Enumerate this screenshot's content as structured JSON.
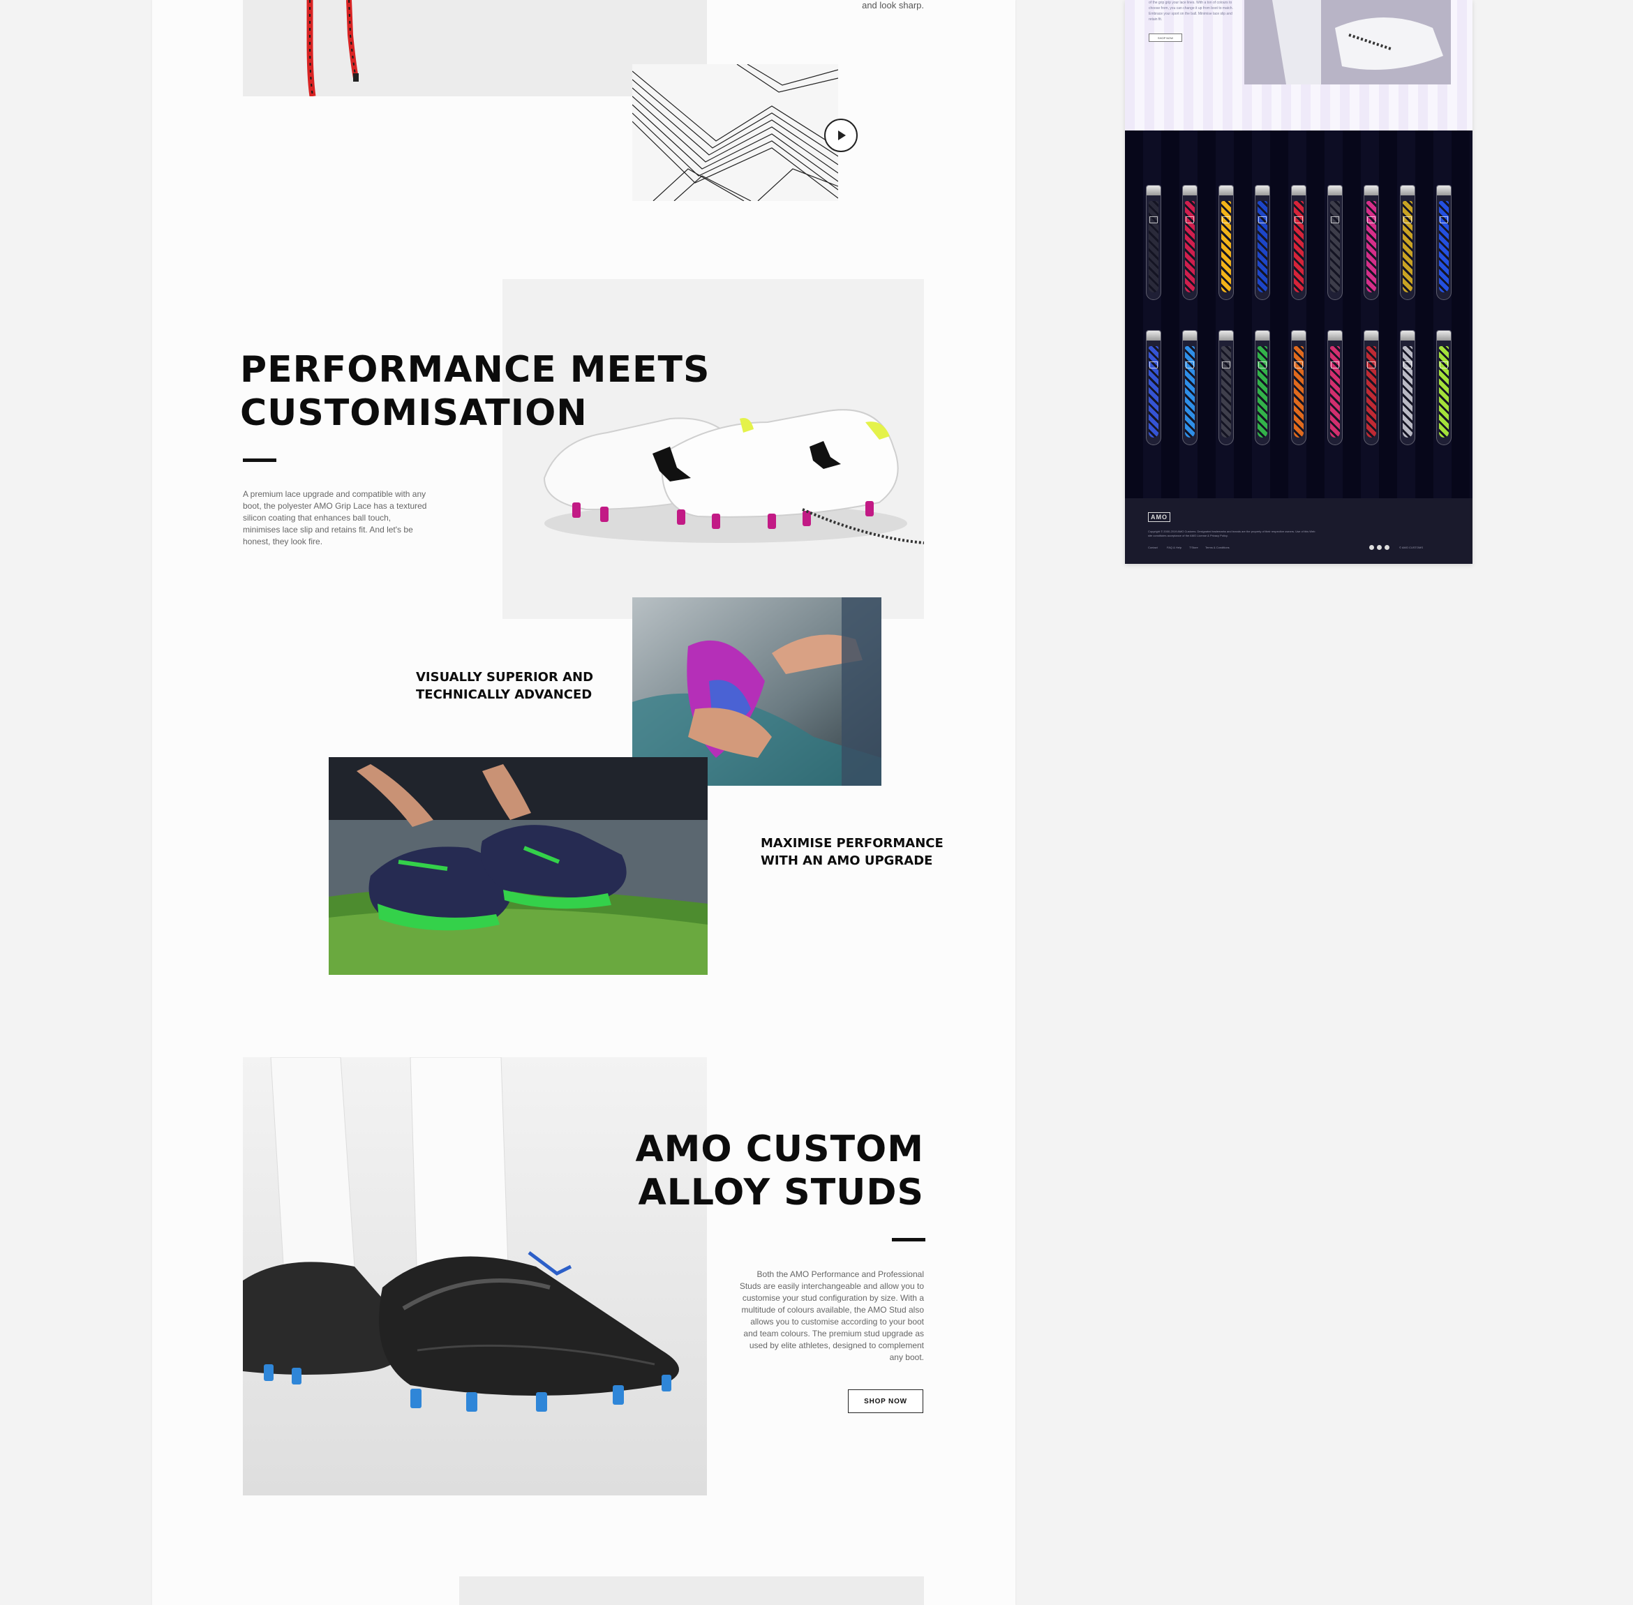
{
  "top": {
    "caption": "and look sharp.",
    "play_icon": "play-icon"
  },
  "performance": {
    "title_line1": "PERFORMANCE MEETS",
    "title_line2": "CUSTOMISATION",
    "body": "A premium lace upgrade and compatible with any boot, the polyester AMO Grip Lace has a textured silicon coating that enhances ball touch, minimises lace slip and retains fit. And let's be honest, they look fire.",
    "visual_line1": "VISUALLY SUPERIOR AND",
    "visual_line2": "TECHNICALLY ADVANCED",
    "maximise_line1": "MAXIMISE PERFORMANCE",
    "maximise_line2": "WITH AN AMO UPGRADE"
  },
  "studs": {
    "title_line1": "AMO CUSTOM",
    "title_line2": "ALLOY STUDS",
    "body": "Both the AMO Performance and Professional Studs are easily interchangeable and allow you to customise your stud configuration by size. With a multitude of colours available, the AMO Stud also allows you to customise according to your boot and team colours. The premium stud upgrade as used by elite athletes, designed to complement any boot.",
    "shop_label": "SHOP NOW"
  },
  "preview": {
    "copy": "of the grip grip your lace lines. With a ton of colours to choose from, you can change it up from boot to match. Embrace your sport on the ball. Minimise lace slip and retain fit.",
    "shop_label": "SHOP NOW",
    "footer_logo": "AMO",
    "footer_copy": "Copyright © 2000-2019 AMO Customs. Designated trademarks and brands are the property of their respective owners. Use of this Web site constitutes acceptance of the AMO License & Privacy Policy.",
    "footer_links": [
      "Contact",
      "FAQ & Help",
      "T'Store",
      "Terms & Conditions"
    ],
    "footer_right": "© AMO CUSTOMS",
    "tube_colors_row1": [
      "#2a2a3a",
      "#d01f4e",
      "#f2b319",
      "#1d46c8",
      "#d6243a",
      "#3d3d4a",
      "#d62f8a",
      "#c9a324",
      "#2450e0"
    ],
    "tube_colors_row2": [
      "#3554d4",
      "#2f8fe8",
      "#3f3f4c",
      "#33b24a",
      "#e06a1e",
      "#d22f6e",
      "#c02a34",
      "#b9b9c4",
      "#a4e13a"
    ]
  },
  "colors": {
    "page_bg": "#f3f3f3",
    "content_bg": "#fcfcfc",
    "text_dark": "#0c0c0c",
    "lace_red": "#e02a2a",
    "dark_panel": "#07071a"
  }
}
